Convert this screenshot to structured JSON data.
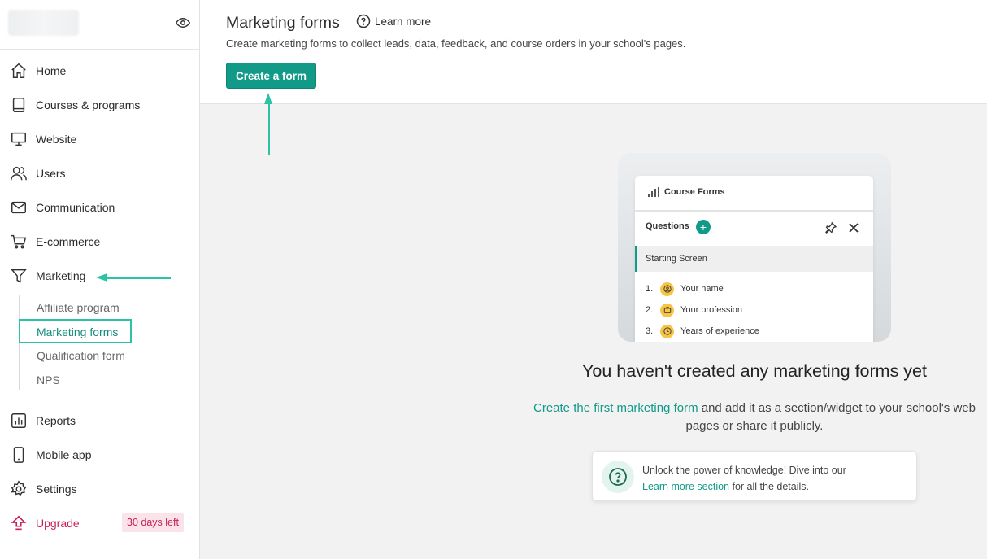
{
  "sidebar": {
    "items": [
      {
        "label": "Home",
        "icon": "home-icon"
      },
      {
        "label": "Courses & programs",
        "icon": "book-icon"
      },
      {
        "label": "Website",
        "icon": "monitor-icon"
      },
      {
        "label": "Users",
        "icon": "users-icon"
      },
      {
        "label": "Communication",
        "icon": "mail-icon"
      },
      {
        "label": "E-commerce",
        "icon": "cart-icon"
      },
      {
        "label": "Marketing",
        "icon": "funnel-icon"
      },
      {
        "label": "Reports",
        "icon": "chart-icon"
      },
      {
        "label": "Mobile app",
        "icon": "phone-icon"
      },
      {
        "label": "Settings",
        "icon": "gear-icon"
      },
      {
        "label": "Upgrade",
        "icon": "upgrade-icon"
      }
    ],
    "marketing_sub": [
      "Affiliate program",
      "Marketing forms",
      "Qualification form",
      "NPS"
    ],
    "active_sub": "Marketing forms",
    "upgrade_badge": "30 days left"
  },
  "header": {
    "title": "Marketing forms",
    "learn_more": "Learn more",
    "subtitle": "Create marketing forms to collect leads, data, feedback, and course orders in your school's pages.",
    "create_button": "Create a form"
  },
  "illustration": {
    "card_title": "Course Forms",
    "questions_label": "Questions",
    "starting_screen": "Starting Screen",
    "questions": [
      {
        "num": "1.",
        "text": "Your name",
        "icon": "person-icon"
      },
      {
        "num": "2.",
        "text": "Your profession",
        "icon": "briefcase-icon"
      },
      {
        "num": "3.",
        "text": "Years of experience",
        "icon": "clock-icon"
      }
    ]
  },
  "empty": {
    "title": "You haven't created any marketing forms yet",
    "link": "Create the first marketing form",
    "text": " and add it as a section/widget to your school's web pages or share it publicly."
  },
  "tip": {
    "line1": "Unlock the power of knowledge! Dive into our",
    "link": "Learn more section",
    "line2": " for all the details."
  },
  "colors": {
    "accent": "#129a88",
    "highlight": "#2cc3a4",
    "upgrade": "#c8225d"
  }
}
